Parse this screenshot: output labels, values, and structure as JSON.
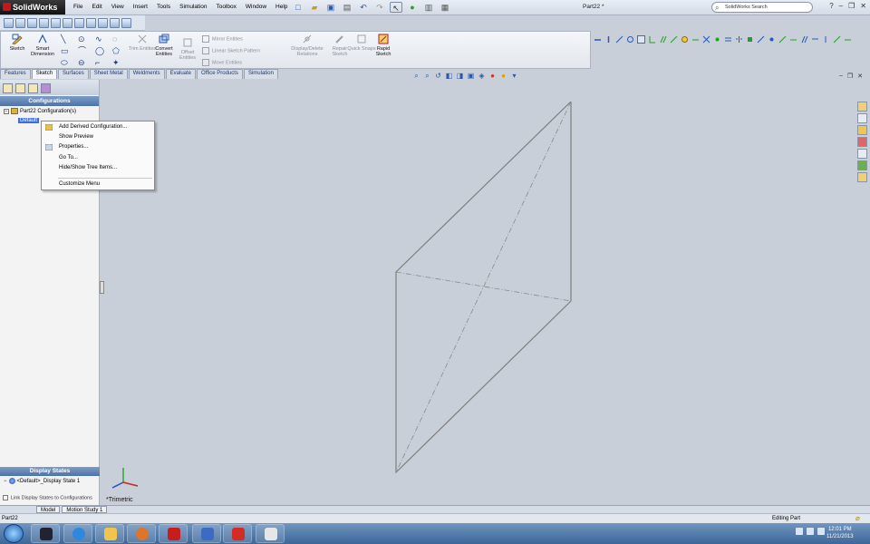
{
  "app": {
    "name": "SolidWorks",
    "doc_title": "Part22 *",
    "search_placeholder": "SolidWorks Search"
  },
  "menu": [
    "File",
    "Edit",
    "View",
    "Insert",
    "Tools",
    "Simulation",
    "Toolbox",
    "Window",
    "Help"
  ],
  "command_manager": {
    "sketch": "Sketch",
    "smart_dimension": "Smart Dimension",
    "trim_entities": "Trim Entities",
    "convert_entities": "Convert Entities",
    "offset_entities": "Offset Entities",
    "mirror_entities": "Mirror Entities",
    "linear_sketch_pattern": "Linear Sketch Pattern",
    "move_entities": "Move Entities",
    "display_delete_relations": "Display/Delete Relations",
    "repair_sketch": "Repair Sketch",
    "quick_snaps": "Quick Snaps",
    "rapid_sketch": "Rapid Sketch"
  },
  "tabs": [
    "Features",
    "Sketch",
    "Surfaces",
    "Sheet Metal",
    "Weldments",
    "Evaluate",
    "Office Products",
    "Simulation"
  ],
  "active_tab": "Sketch",
  "configurations": {
    "header": "Configurations",
    "root": "Part22 Configuration(s)",
    "child": "Default [ Part22 ]",
    "child_visible": "Default"
  },
  "context_menu": {
    "items": [
      "Add Derived Configuration...",
      "Show Preview",
      "Properties...",
      "Go To...",
      "Hide/Show Tree Items...",
      "Customize Menu"
    ]
  },
  "display_states": {
    "header": "Display States",
    "item": "<Default>_Display State 1",
    "link": "Link Display States to Configurations"
  },
  "view": {
    "orientation": "*Trimetric"
  },
  "bottom_tabs": [
    "Model",
    "Motion Study 1"
  ],
  "status": {
    "left": "Part22",
    "right": "Editing Part"
  },
  "taskbar": {
    "time": "12:01 PM",
    "date": "11/21/2013"
  }
}
